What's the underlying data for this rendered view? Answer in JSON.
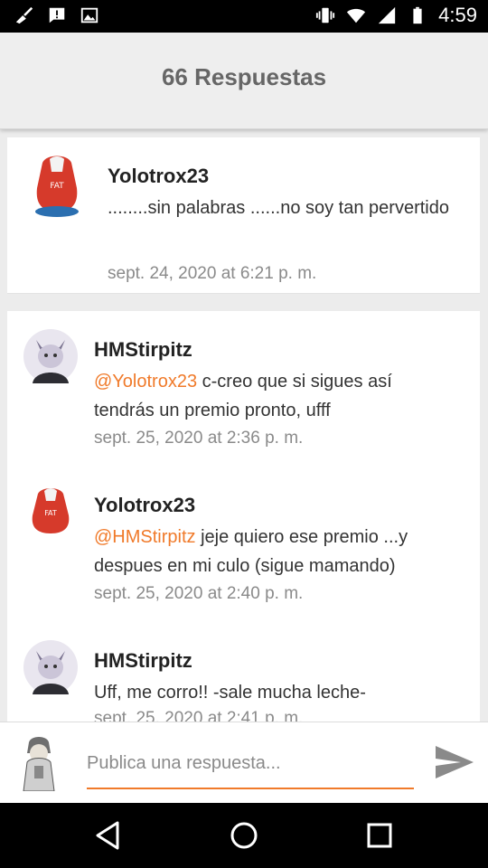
{
  "status_bar": {
    "time": "4:59",
    "left_icons": [
      "broom-icon",
      "alert-message-icon",
      "image-icon"
    ],
    "right_icons": [
      "vibrate-icon",
      "wifi-icon",
      "signal-icon",
      "battery-icon"
    ]
  },
  "header": {
    "title": "66 Respuestas"
  },
  "accent_color": "#f07a2a",
  "comments": [
    {
      "author": "Yolotrox23",
      "mention": "",
      "text": "........sin palabras ......no soy tan pervertido",
      "timestamp": "sept. 24, 2020 at 6:21 p. m.",
      "avatar": "red-hoodie-avatar"
    },
    {
      "author": "HMStirpitz",
      "mention": "@Yolotrox23",
      "text": " c-creo que si sigues así tendrás un premio pronto, ufff",
      "timestamp": "sept. 25, 2020 at 2:36 p. m.",
      "avatar": "wolf-avatar"
    },
    {
      "author": "Yolotrox23",
      "mention": "@HMStirpitz",
      "text": " jeje quiero ese premio ...y despues en mi culo (sigue mamando)",
      "timestamp": "sept. 25, 2020 at 2:40 p. m.",
      "avatar": "red-hoodie-avatar"
    },
    {
      "author": "HMStirpitz",
      "mention": "",
      "text": "Uff, me corro!! -sale mucha leche-",
      "timestamp": "sept. 25, 2020 at 2:41 p. m.",
      "avatar": "wolf-avatar"
    }
  ],
  "composer": {
    "placeholder": "Publica una respuesta...",
    "avatar": "user-avatar",
    "send_icon": "send-icon"
  },
  "nav_bar": {
    "icons": [
      "back-icon",
      "home-icon",
      "recents-icon"
    ]
  }
}
